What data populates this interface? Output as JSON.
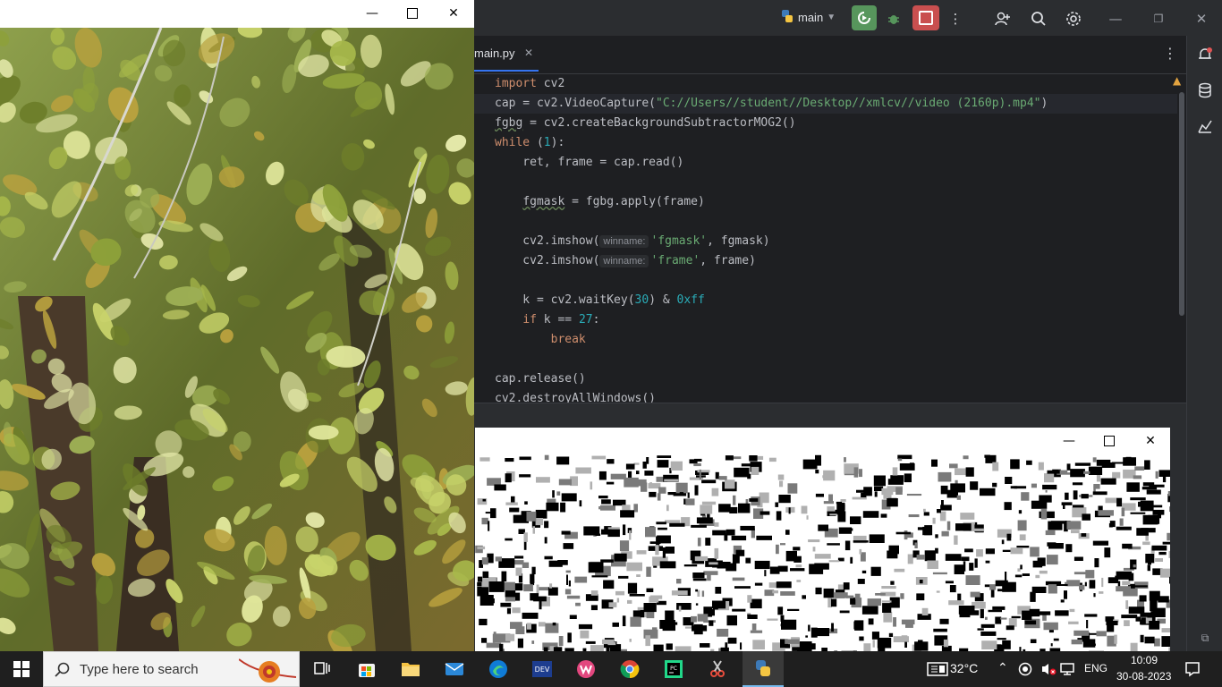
{
  "ide": {
    "branch": "main",
    "tab_title": "main.py",
    "tab_close": "✕",
    "code": {
      "l1_kw": "import",
      "l1_rest": " cv2",
      "l2_a": "cap = cv2.VideoCapture(",
      "l2_str": "\"C://Users//student//Desktop//xmlcv//video (2160p).mp4\"",
      "l2_b": ")",
      "l3_var": "fgbg",
      "l3_rest": " = cv2.createBackgroundSubtractorMOG2()",
      "l4_kw": "while",
      "l4_a": " (",
      "l4_num": "1",
      "l4_b": "):",
      "l5": "    ret, frame = cap.read()",
      "l7_indent": "    ",
      "l7_var": "fgmask",
      "l7_rest": " = fgbg.apply(frame)",
      "l9_a": "    cv2.imshow(",
      "l9_hint": "winname:",
      "l9_str": "'fgmask'",
      "l9_b": ", fgmask)",
      "l10_a": "    cv2.imshow(",
      "l10_hint": "winname:",
      "l10_str": "'frame'",
      "l10_b": ", frame)",
      "l12_a": "    k = cv2.waitKey(",
      "l12_num1": "30",
      "l12_b": ") & ",
      "l12_num2": "0xff",
      "l13_indent": "    ",
      "l13_kw": "if",
      "l13_a": " k == ",
      "l13_num": "27",
      "l13_b": ":",
      "l14_indent": "        ",
      "l14_kw": "break",
      "l16": "cap.release()",
      "l17": "cv2.destroyAllWindows()"
    }
  },
  "taskbar": {
    "search_placeholder": "Type here to search",
    "weather": "32°C",
    "language": "ENG",
    "time": "10:09",
    "date": "30-08-2023"
  },
  "colors": {
    "run": "#57965c",
    "stop": "#c94f4f",
    "accent": "#3574f0"
  }
}
